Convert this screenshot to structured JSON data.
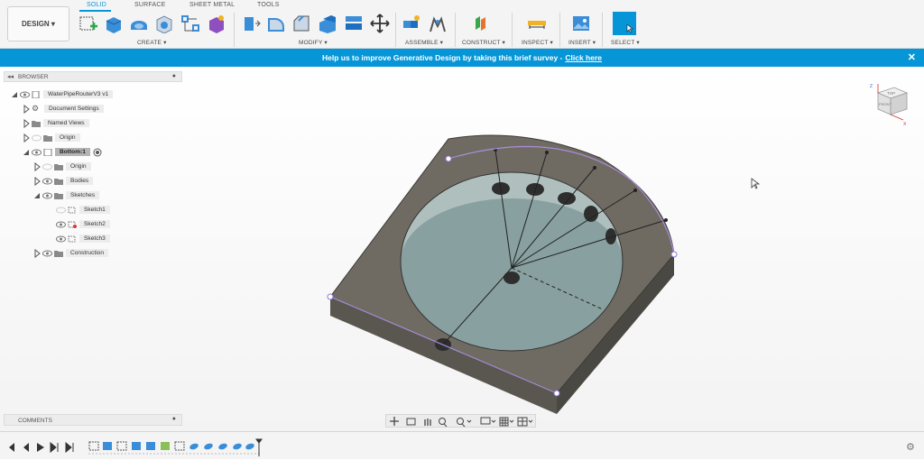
{
  "toolbar": {
    "design_label": "DESIGN ▾",
    "tabs": [
      "SOLID",
      "SURFACE",
      "SHEET METAL",
      "TOOLS"
    ],
    "groups": [
      "CREATE ▾",
      "MODIFY ▾",
      "ASSEMBLE ▾",
      "CONSTRUCT ▾",
      "INSPECT ▾",
      "INSERT ▾",
      "SELECT ▾"
    ]
  },
  "banner": {
    "text": "Help us to improve Generative Design by taking this brief survey -",
    "link": "Click here",
    "close": "✕"
  },
  "browser": {
    "title": "BROWSER",
    "items": [
      {
        "label": "WaterPipeRouterV3 v1",
        "icon": "document-icon"
      },
      {
        "label": "Document Settings",
        "icon": "gear-icon"
      },
      {
        "label": "Named Views",
        "icon": "folder-icon"
      },
      {
        "label": "Origin",
        "icon": "folder-icon"
      },
      {
        "label": "Bottom:1",
        "icon": "component-icon"
      },
      {
        "label": "Origin",
        "icon": "folder-icon"
      },
      {
        "label": "Bodies",
        "icon": "folder-icon"
      },
      {
        "label": "Sketches",
        "icon": "folder-icon"
      },
      {
        "label": "Sketch1",
        "icon": "sketch-icon"
      },
      {
        "label": "Sketch2",
        "icon": "sketch-icon"
      },
      {
        "label": "Sketch3",
        "icon": "sketch-icon"
      },
      {
        "label": "Construction",
        "icon": "folder-icon"
      }
    ]
  },
  "comments": {
    "title": "COMMENTS"
  },
  "viewcube": {
    "top": "TOP",
    "front": "FRONT",
    "z": "Z",
    "x": "X"
  },
  "colors": {
    "accent": "#0696d7",
    "model_face": "#6e6a62",
    "model_side": "#57544e",
    "cavity": "#9aaeae"
  }
}
